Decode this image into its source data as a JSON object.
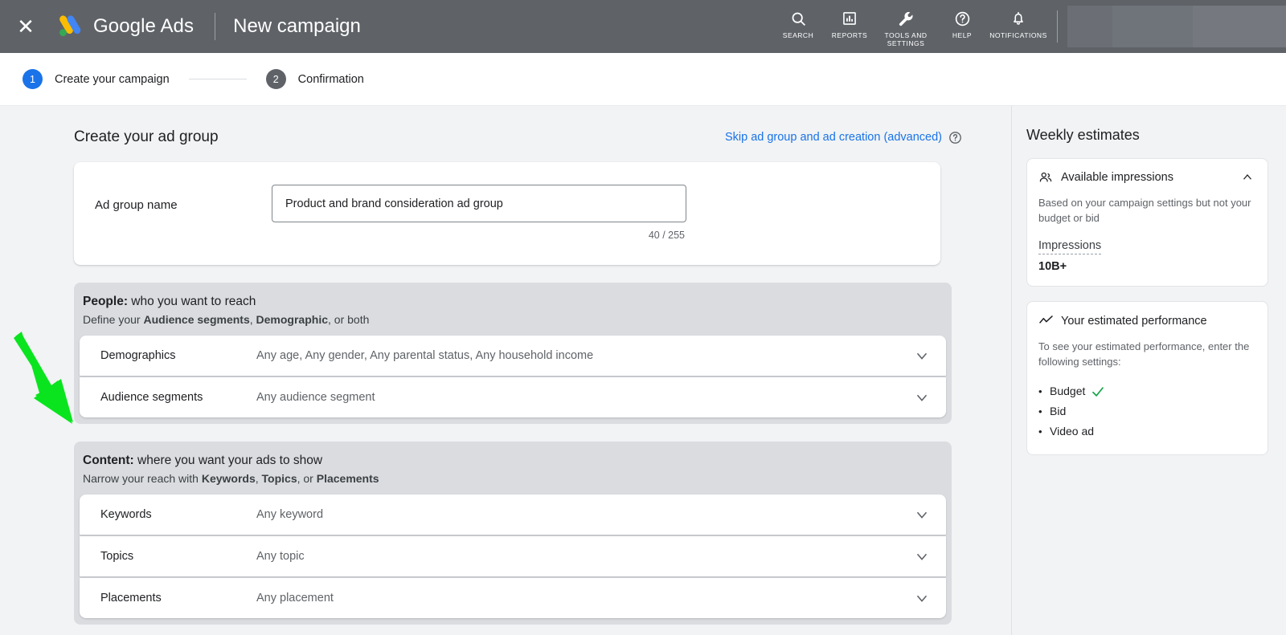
{
  "topbar": {
    "close_icon": "close-icon",
    "brand_google": "Google",
    "brand_ads": "Ads",
    "page_title": "New campaign",
    "actions": [
      {
        "label": "SEARCH",
        "icon": "search-icon"
      },
      {
        "label": "REPORTS",
        "icon": "reports-icon"
      },
      {
        "label": "TOOLS AND SETTINGS",
        "icon": "wrench-icon"
      },
      {
        "label": "HELP",
        "icon": "help-icon"
      },
      {
        "label": "NOTIFICATIONS",
        "icon": "bell-icon"
      }
    ]
  },
  "stepper": {
    "steps": [
      {
        "number": "1",
        "label": "Create your campaign",
        "state": "active"
      },
      {
        "number": "2",
        "label": "Confirmation",
        "state": "inactive"
      }
    ]
  },
  "main": {
    "section_title": "Create your ad group",
    "skip_link": "Skip ad group and ad creation (advanced)",
    "ad_group": {
      "label": "Ad group name",
      "value": "Product and brand consideration ad group",
      "placeholder": "Ad group name",
      "char_count": "40 / 255"
    },
    "people": {
      "title_bold": "People:",
      "title_rest": " who you want to reach",
      "sub_pre": "Define your ",
      "sub_b1": "Audience segments",
      "sub_mid": ", ",
      "sub_b2": "Demographic",
      "sub_post": ", or both",
      "rows": [
        {
          "label": "Demographics",
          "value": "Any age, Any gender, Any parental status, Any household income"
        },
        {
          "label": "Audience segments",
          "value": "Any audience segment"
        }
      ]
    },
    "content": {
      "title_bold": "Content:",
      "title_rest": " where you want your ads to show",
      "sub_pre": "Narrow your reach with ",
      "sub_b1": "Keywords",
      "sub_mid": ", ",
      "sub_b2": "Topics",
      "sub_mid2": ", or ",
      "sub_b3": "Placements",
      "rows": [
        {
          "label": "Keywords",
          "value": "Any keyword"
        },
        {
          "label": "Topics",
          "value": "Any topic"
        },
        {
          "label": "Placements",
          "value": "Any placement"
        }
      ]
    }
  },
  "right_panel": {
    "title": "Weekly estimates",
    "impressions_card": {
      "icon": "people-icon",
      "title": "Available impressions",
      "collapse_icon": "chevron-up-icon",
      "description": "Based on your campaign settings but not your budget or bid",
      "metric_label": "Impressions",
      "metric_value": "10B+"
    },
    "performance_card": {
      "icon": "trend-line-icon",
      "title": "Your estimated performance",
      "description": "To see your estimated performance, enter the following settings:",
      "items": [
        {
          "label": "Budget",
          "done": true
        },
        {
          "label": "Bid",
          "done": false
        },
        {
          "label": "Video ad",
          "done": false
        }
      ]
    }
  },
  "annotation": {
    "arrow": "green-arrow-pointer"
  },
  "colors": {
    "topbar_bg": "#5f6368",
    "accent_blue": "#1a73e8",
    "group_bg": "#dadce0",
    "page_bg": "#f1f3f4",
    "arrow_green": "#0ae41f",
    "check_green": "#16a34a"
  }
}
